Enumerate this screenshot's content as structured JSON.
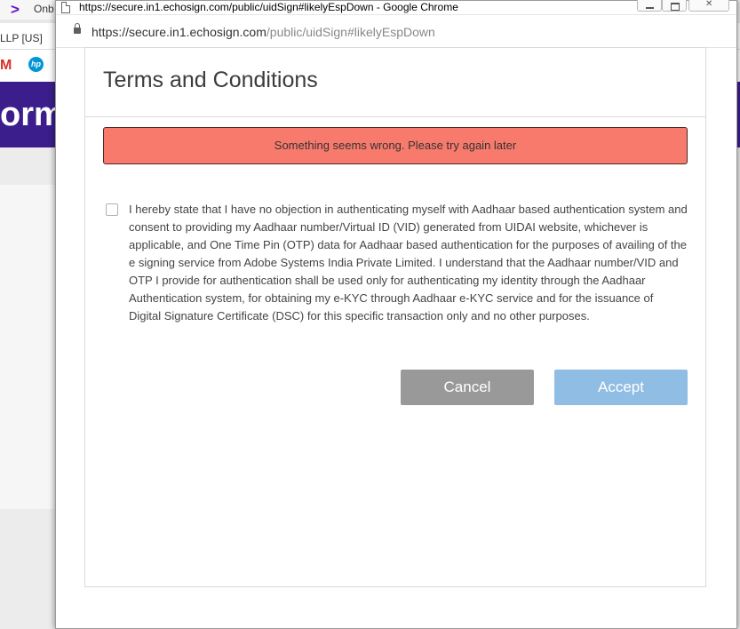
{
  "background": {
    "tab_title": "Onb",
    "tab_logo": ">",
    "address_fragment": "LLP [US]",
    "bookmark_gmail": "M",
    "bookmark_hp": "hp",
    "hero_text": "orm"
  },
  "window": {
    "title": "https://secure.in1.echosign.com/public/uidSign#likelyEspDown - Google Chrome"
  },
  "address_bar": {
    "host": "https://secure.in1.echosign.com",
    "path": "/public/uidSign#likelyEspDown"
  },
  "dialog": {
    "title": "Terms and Conditions",
    "error_message": "Something seems wrong. Please try again later",
    "consent_checked": false,
    "consent_text": "I hereby state that I have no objection in authenticating myself with Aadhaar based authentication system and consent to providing my Aadhaar number/Virtual ID (VID) generated from UIDAI website, whichever is applicable, and One Time Pin (OTP) data for Aadhaar based authentication for the purposes of availing of the e signing service from Adobe Systems India Private Limited. I understand that the Aadhaar number/VID and OTP I provide for authentication shall be used only for authenticating my identity through the Aadhaar Authentication system, for obtaining my e-KYC through Aadhaar e-KYC service and for the issuance of Digital Signature Certificate (DSC) for this specific transaction only and no other purposes.",
    "cancel_label": "Cancel",
    "accept_label": "Accept"
  },
  "colors": {
    "error_banner": "#f87a6d",
    "cancel_button": "#999999",
    "accept_button_disabled": "#90bde3",
    "background_hero": "#3b1e8c"
  }
}
